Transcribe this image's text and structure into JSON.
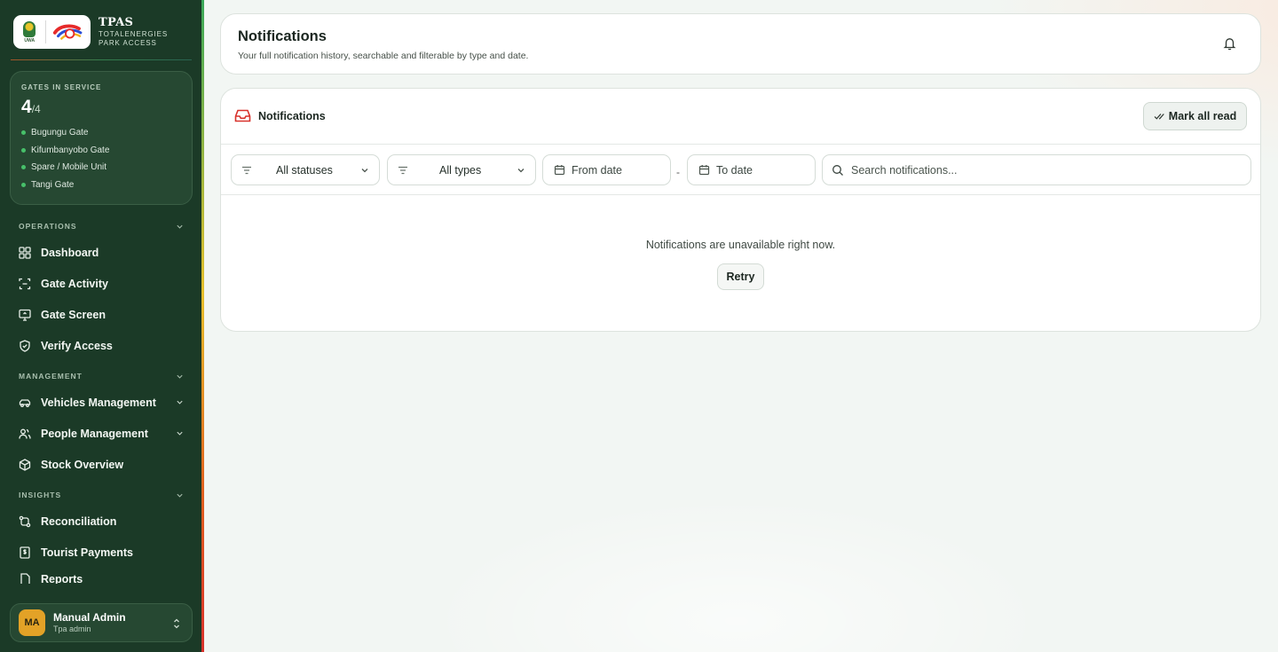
{
  "brand": {
    "title": "TPAS",
    "subtitle_line1": "TOTALENERGIES",
    "subtitle_line2": "PARK ACCESS",
    "logo_text": "UWA"
  },
  "gates": {
    "label": "GATES IN SERVICE",
    "count": "4",
    "total": "/4",
    "items": [
      "Bugungu Gate",
      "Kifumbanyobo Gate",
      "Spare / Mobile Unit",
      "Tangi Gate"
    ],
    "status_color": "#47c06a"
  },
  "nav": {
    "operations_label": "OPERATIONS",
    "management_label": "MANAGEMENT",
    "insights_label": "INSIGHTS",
    "items": {
      "dashboard": "Dashboard",
      "gate_activity": "Gate Activity",
      "gate_screen": "Gate Screen",
      "verify_access": "Verify Access",
      "vehicles_management": "Vehicles Management",
      "people_management": "People Management",
      "stock_overview": "Stock Overview",
      "reconciliation": "Reconciliation",
      "tourist_payments": "Tourist Payments",
      "reports": "Reports"
    }
  },
  "user": {
    "initials": "MA",
    "name": "Manual Admin",
    "role": "Tpa admin"
  },
  "header": {
    "title": "Notifications",
    "subtitle": "Your full notification history, searchable and filterable by type and date."
  },
  "notifications": {
    "card_title": "Notifications",
    "mark_all_label": "Mark all read",
    "filters": {
      "status_value": "All statuses",
      "type_value": "All types",
      "from_placeholder": "From date",
      "to_placeholder": "To date",
      "separator": "-",
      "search_placeholder": "Search notifications..."
    },
    "empty_message": "Notifications are unavailable right now.",
    "retry_label": "Retry"
  },
  "colors": {
    "sidebar_bg": "#1b3a27",
    "accent_red": "#d8322c",
    "avatar_bg": "#e3a227"
  }
}
